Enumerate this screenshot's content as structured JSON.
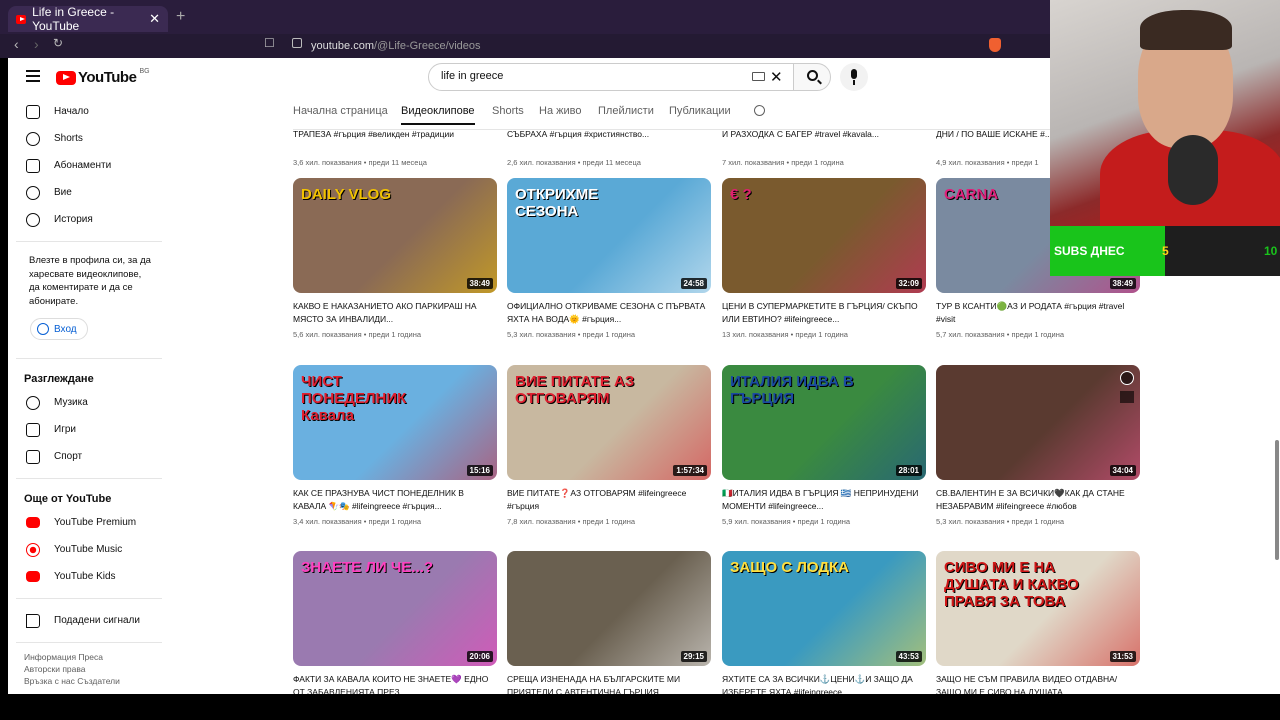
{
  "browser": {
    "tab_title": "Life in Greece - YouTube",
    "url_host": "youtube.com",
    "url_path": "/@Life-Greece/videos",
    "new_tab": "+",
    "close": "✕"
  },
  "header": {
    "logo_text": "YouTube",
    "logo_region": "BG",
    "search_value": "life in greece",
    "clear": "✕"
  },
  "sidebar": {
    "main": [
      {
        "label": "Начало"
      },
      {
        "label": "Shorts"
      },
      {
        "label": "Абонаменти"
      },
      {
        "label": "Вие"
      },
      {
        "label": "История"
      }
    ],
    "signin_text": "Влезте в профила си, за да харесвате видеоклипове, да коментирате и да се абонирате.",
    "signin_button": "Вход",
    "explore_title": "Разглеждане",
    "explore": [
      {
        "label": "Музика"
      },
      {
        "label": "Игри"
      },
      {
        "label": "Спорт"
      }
    ],
    "more_title": "Още от YouTube",
    "more": [
      {
        "label": "YouTube Premium"
      },
      {
        "label": "YouTube Music"
      },
      {
        "label": "YouTube Kids"
      }
    ],
    "report": "Подадени сигнали",
    "footer": [
      "Информация  Преса",
      "Авторски права",
      "Връзка с нас  Създатели"
    ]
  },
  "channel_tabs": [
    "Начална страница",
    "Видеоклипове",
    "Shorts",
    "На живо",
    "Плейлисти",
    "Публикации"
  ],
  "top_row": [
    {
      "title": "ТРАПЕЗА #гърция #великден #традиции",
      "meta": "3,6 хил. показвания • преди 11 месеца"
    },
    {
      "title": "СЪБРАХА #гърция #християнство...",
      "meta": "2,6 хил. показвания • преди 11 месеца"
    },
    {
      "title": "И РАЗХОДКА С БАГЕР #travel #kavala...",
      "meta": "7 хил. показвания • преди 1 година"
    },
    {
      "title": "ДНИ / ПО ВАШЕ ИСКАНЕ #...",
      "meta": "4,9 хил. показвания • преди 1"
    }
  ],
  "rows": [
    [
      {
        "title": "КАКВО Е НАКАЗАНИЕТО АКО ПАРКИРАШ НА МЯСТО ЗА ИНВАЛИДИ...",
        "meta": "5,6 хил. показвания • преди 1 година",
        "duration": "38:49",
        "overlay": "DAILY VLOG",
        "bg": "#8a6a55",
        "accent": "#f2c200"
      },
      {
        "title": "ОФИЦИАЛНО ОТКРИВАМЕ СЕЗОНА С ПЪРВАТА ЯХТА НА ВОДА🌞 #гърция...",
        "meta": "5,3 хил. показвания • преди 1 година",
        "duration": "24:58",
        "overlay": "ОТКРИХМЕ СЕЗОНА",
        "bg": "#5aa9d6",
        "accent": "#ffffff"
      },
      {
        "title": "ЦЕНИ В СУПЕРМАРКЕТИТЕ В ГЪРЦИЯ/ СКЪПО ИЛИ ЕВТИНО? #lifeingreece...",
        "meta": "13 хил. показвания • преди 1 година",
        "duration": "32:09",
        "overlay": "€ ?",
        "bg": "#7a5a2e",
        "accent": "#e02070"
      },
      {
        "title": "ТУР В КСАНТИ🟢АЗ И РОДАТА #гърция #travel #visit",
        "meta": "5,7 хил. показвания • преди 1 година",
        "duration": "38:49",
        "overlay": "CARNA",
        "bg": "#7a8aa0",
        "accent": "#e0207a"
      }
    ],
    [
      {
        "title": "КАК СЕ ПРАЗНУВА ЧИСТ ПОНЕДЕЛНИК В КАВАЛА 🪁🎭 #lifeingreece #гърция...",
        "meta": "3,4 хил. показвания • преди 1 година",
        "duration": "15:16",
        "overlay": "ЧИСТ ПОНЕДЕЛНИК Кавала",
        "bg": "#6ab0e0",
        "accent": "#e02030"
      },
      {
        "title": "ВИЕ ПИТАТЕ❓АЗ ОТГОВАРЯМ #lifeingreece #гърция",
        "meta": "7,8 хил. показвания • преди 1 година",
        "duration": "1:57:34",
        "overlay": "ВИЕ ПИТАТЕ АЗ ОТГОВАРЯМ",
        "bg": "#c8b8a0",
        "accent": "#e02030"
      },
      {
        "title": "🇮🇹ИТАЛИЯ ИДВА В ГЪРЦИЯ 🇬🇷 НЕПРИНУДЕНИ МОМЕНТИ #lifeingreece...",
        "meta": "5,9 хил. показвания • преди 1 година",
        "duration": "28:01",
        "overlay": "ИТАЛИЯ ИДВА В ГЪРЦИЯ",
        "bg": "#3a8a40",
        "accent": "#1a4aa0"
      },
      {
        "title": "СВ.ВАЛЕНТИН Е ЗА ВСИЧКИ🖤КАК ДА СТАНЕ НЕЗАБРАВИМ #lifeingreece #любов",
        "meta": "5,3 хил. показвания • преди 1 година",
        "duration": "34:04",
        "overlay": "",
        "bg": "#5a3a30",
        "accent": "#ff5a9a"
      }
    ],
    [
      {
        "title": "ФАКТИ ЗА КАВАЛА КОИТО НЕ ЗНАЕТЕ💜 ЕДНО ОТ ЗАБАВЛЕНИЯТА ПРЕЗ...",
        "meta": "",
        "duration": "20:06",
        "overlay": "ЗНАЕТЕ ЛИ ЧЕ...?",
        "bg": "#9a7ab0",
        "accent": "#ff40c0"
      },
      {
        "title": "СРЕЩА ИЗНЕНАДА НА БЪЛГАРСКИТЕ МИ ПРИЯТЕЛИ С АВТЕНТИЧНА ГЪРЦИЯ...",
        "meta": "",
        "duration": "29:15",
        "overlay": "",
        "bg": "#6a6050",
        "accent": "#ffffff"
      },
      {
        "title": "ЯХТИТЕ СА ЗА ВСИЧКИ⚓ЦЕНИ⚓И ЗАЩО ДА ИЗБЕРЕТЕ ЯХТА #lifeingreece...",
        "meta": "",
        "duration": "43:53",
        "overlay": "ЗАЩО С ЛОДКА",
        "bg": "#3a9ac0",
        "accent": "#ffe040"
      },
      {
        "title": "ЗАЩО НЕ СЪМ ПРАВИЛА ВИДЕО ОТДАВНА/ЗАЩО МИ Е СИВО НА ДУШАТА",
        "meta": "",
        "duration": "31:53",
        "overlay": "СИВО МИ Е НА ДУШАТА И КАКВО ПРАВЯ ЗА ТОВА",
        "bg": "#e0d8c8",
        "accent": "#d01818"
      }
    ]
  ],
  "overlay": {
    "subs_label": "SUBS ДНЕС",
    "subs_value": "5",
    "subs_goal": "10",
    "subs_fraction": 0.5
  }
}
